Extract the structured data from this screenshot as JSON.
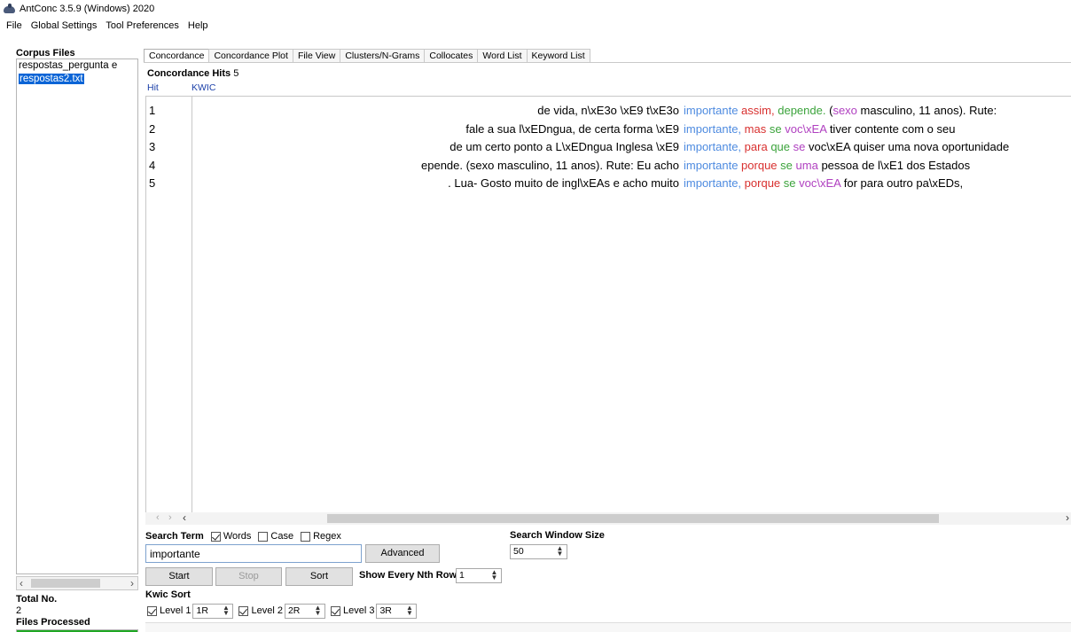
{
  "window": {
    "title": "AntConc 3.5.9 (Windows) 2020"
  },
  "menu": [
    "File",
    "Global Settings",
    "Tool Preferences",
    "Help"
  ],
  "corpus": {
    "header": "Corpus Files",
    "files": [
      {
        "name": "respostas_pergunta e",
        "selected": false
      },
      {
        "name": "respostas2.txt",
        "selected": true
      }
    ],
    "total_label": "Total No.",
    "total_value": "2",
    "processed_label": "Files Processed",
    "processed_fraction": 1.0
  },
  "tabs": [
    {
      "label": "Concordance",
      "active": true
    },
    {
      "label": "Concordance Plot",
      "active": false
    },
    {
      "label": "File View",
      "active": false
    },
    {
      "label": "Clusters/N-Grams",
      "active": false
    },
    {
      "label": "Collocates",
      "active": false
    },
    {
      "label": "Word List",
      "active": false
    },
    {
      "label": "Keyword List",
      "active": false
    }
  ],
  "concordance": {
    "hits_label": "Concordance Hits",
    "hits_count": "5",
    "col_hit": "Hit",
    "col_kwic": "KWIC",
    "rows": [
      {
        "num": "1",
        "left": "de vida, n\\xE3o \\xE9 t\\xE3o",
        "node": "importante",
        "right": [
          {
            "text": "assim,",
            "color": "red"
          },
          {
            "text": "depende.",
            "color": "green"
          },
          {
            "text": "(",
            "color": "black"
          },
          {
            "text": "sexo",
            "color": "purple"
          },
          {
            "text": "masculino, 11 anos).  Rute:",
            "color": "black"
          }
        ]
      },
      {
        "num": "2",
        "left": "fale a sua l\\xEDngua, de certa forma \\xE9",
        "node": "importante,",
        "right": [
          {
            "text": "mas",
            "color": "red"
          },
          {
            "text": "se",
            "color": "green"
          },
          {
            "text": "voc\\xEA",
            "color": "purple"
          },
          {
            "text": "tiver contente com o seu",
            "color": "black"
          }
        ]
      },
      {
        "num": "3",
        "left": "de um certo ponto a L\\xEDngua Inglesa \\xE9",
        "node": "importante,",
        "right": [
          {
            "text": "para",
            "color": "red"
          },
          {
            "text": "que",
            "color": "green"
          },
          {
            "text": "se",
            "color": "purple"
          },
          {
            "text": "voc\\xEA quiser uma nova oportunidade",
            "color": "black"
          }
        ]
      },
      {
        "num": "4",
        "left": "epende. (sexo masculino, 11 anos).  Rute: Eu acho",
        "node": "importante",
        "right": [
          {
            "text": "porque",
            "color": "red"
          },
          {
            "text": "se",
            "color": "green"
          },
          {
            "text": "uma",
            "color": "purple"
          },
          {
            "text": "pessoa de l\\xE1 dos Estados",
            "color": "black"
          }
        ]
      },
      {
        "num": "5",
        "left": ".  Lua- Gosto muito de ingl\\xEAs e acho muito",
        "node": "importante,",
        "right": [
          {
            "text": "porque",
            "color": "red"
          },
          {
            "text": "se",
            "color": "green"
          },
          {
            "text": "voc\\xEA",
            "color": "purple"
          },
          {
            "text": "for para outro pa\\xEDs,",
            "color": "black"
          }
        ]
      }
    ]
  },
  "search": {
    "term_label": "Search Term",
    "words_label": "Words",
    "words_checked": true,
    "case_label": "Case",
    "case_checked": false,
    "regex_label": "Regex",
    "regex_checked": false,
    "value": "importante",
    "advanced_label": "Advanced",
    "start_label": "Start",
    "stop_label": "Stop",
    "sort_label": "Sort",
    "window_size_label": "Search Window Size",
    "window_size_value": "50",
    "nth_row_label": "Show Every Nth Row",
    "nth_row_value": "1"
  },
  "kwic_sort": {
    "label": "Kwic Sort",
    "levels": [
      {
        "label": "Level 1",
        "checked": true,
        "value": "1R"
      },
      {
        "label": "Level 2",
        "checked": true,
        "value": "2R"
      },
      {
        "label": "Level 3",
        "checked": true,
        "value": "3R"
      }
    ]
  },
  "colors": {
    "node": "#4e8be0",
    "red": "#d8302f",
    "green": "#3ba33b",
    "purple": "#b040c0",
    "progress": "#1fa824",
    "selection": "#0a64d6"
  }
}
